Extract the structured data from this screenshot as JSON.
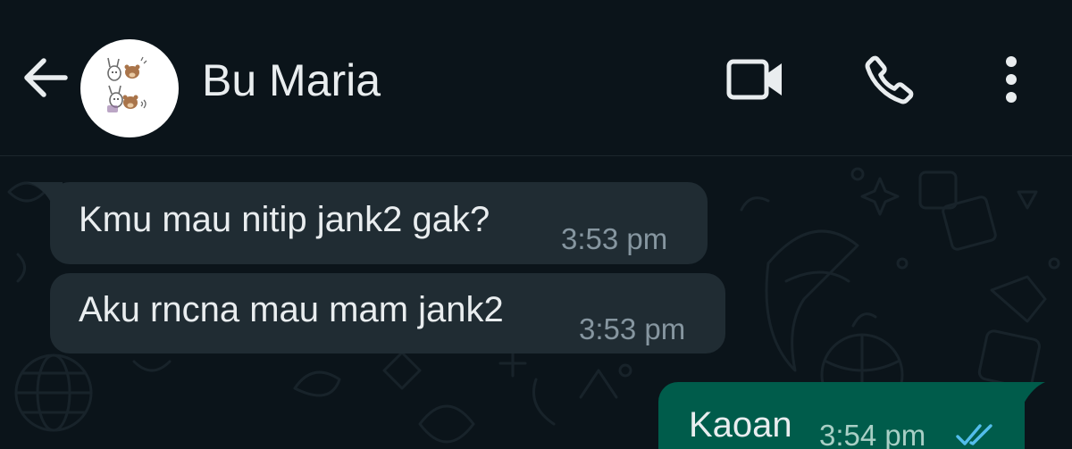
{
  "header": {
    "contact_name": "Bu Maria",
    "avatar_icon": "cartoon-sticker-avatar",
    "back_icon": "arrow-left-icon",
    "video_icon": "video-camera-icon",
    "call_icon": "phone-icon",
    "menu_icon": "more-vertical-icon"
  },
  "colors": {
    "background": "#0b141a",
    "incoming_bubble": "#202c33",
    "outgoing_bubble": "#005c4b",
    "read_ticks": "#53bdeb"
  },
  "messages": [
    {
      "direction": "incoming",
      "text": "Kmu mau nitip jank2 gak?",
      "time": "3:53 pm"
    },
    {
      "direction": "incoming",
      "text": "Aku rncna mau mam jank2",
      "time": "3:53 pm"
    },
    {
      "direction": "outgoing",
      "text": "Kaoan",
      "time": "3:54 pm",
      "status": "read"
    }
  ]
}
